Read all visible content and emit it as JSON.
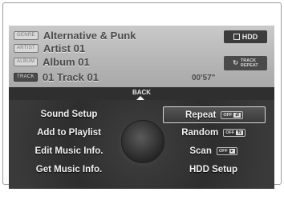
{
  "track_info": {
    "genre_tag": "GENRE",
    "genre": "Alternative & Punk",
    "artist_tag": "ARTIST",
    "artist": "Artist 01",
    "album_tag": "ALBUM",
    "album": "Album 01",
    "track_tag": "TRACK",
    "track": "01 Track 01",
    "elapsed": "00'57\""
  },
  "source_badge": "HDD",
  "mode_badge": {
    "icon": "repeat-icon",
    "line1": "TRACK",
    "line2": "REPEAT"
  },
  "back_label": "BACK",
  "menu": {
    "left": [
      {
        "label": "Sound Setup"
      },
      {
        "label": "Add to Playlist"
      },
      {
        "label": "Edit Music Info."
      },
      {
        "label": "Get Music Info."
      }
    ],
    "right": [
      {
        "label": "Repeat",
        "toggle": "OFF",
        "toggle_icon": "⇄",
        "selected": true
      },
      {
        "label": "Random",
        "toggle": "OFF",
        "toggle_icon": "⇆"
      },
      {
        "label": "Scan",
        "toggle": "OFF",
        "toggle_icon": "▸"
      },
      {
        "label": "HDD Setup"
      }
    ]
  }
}
